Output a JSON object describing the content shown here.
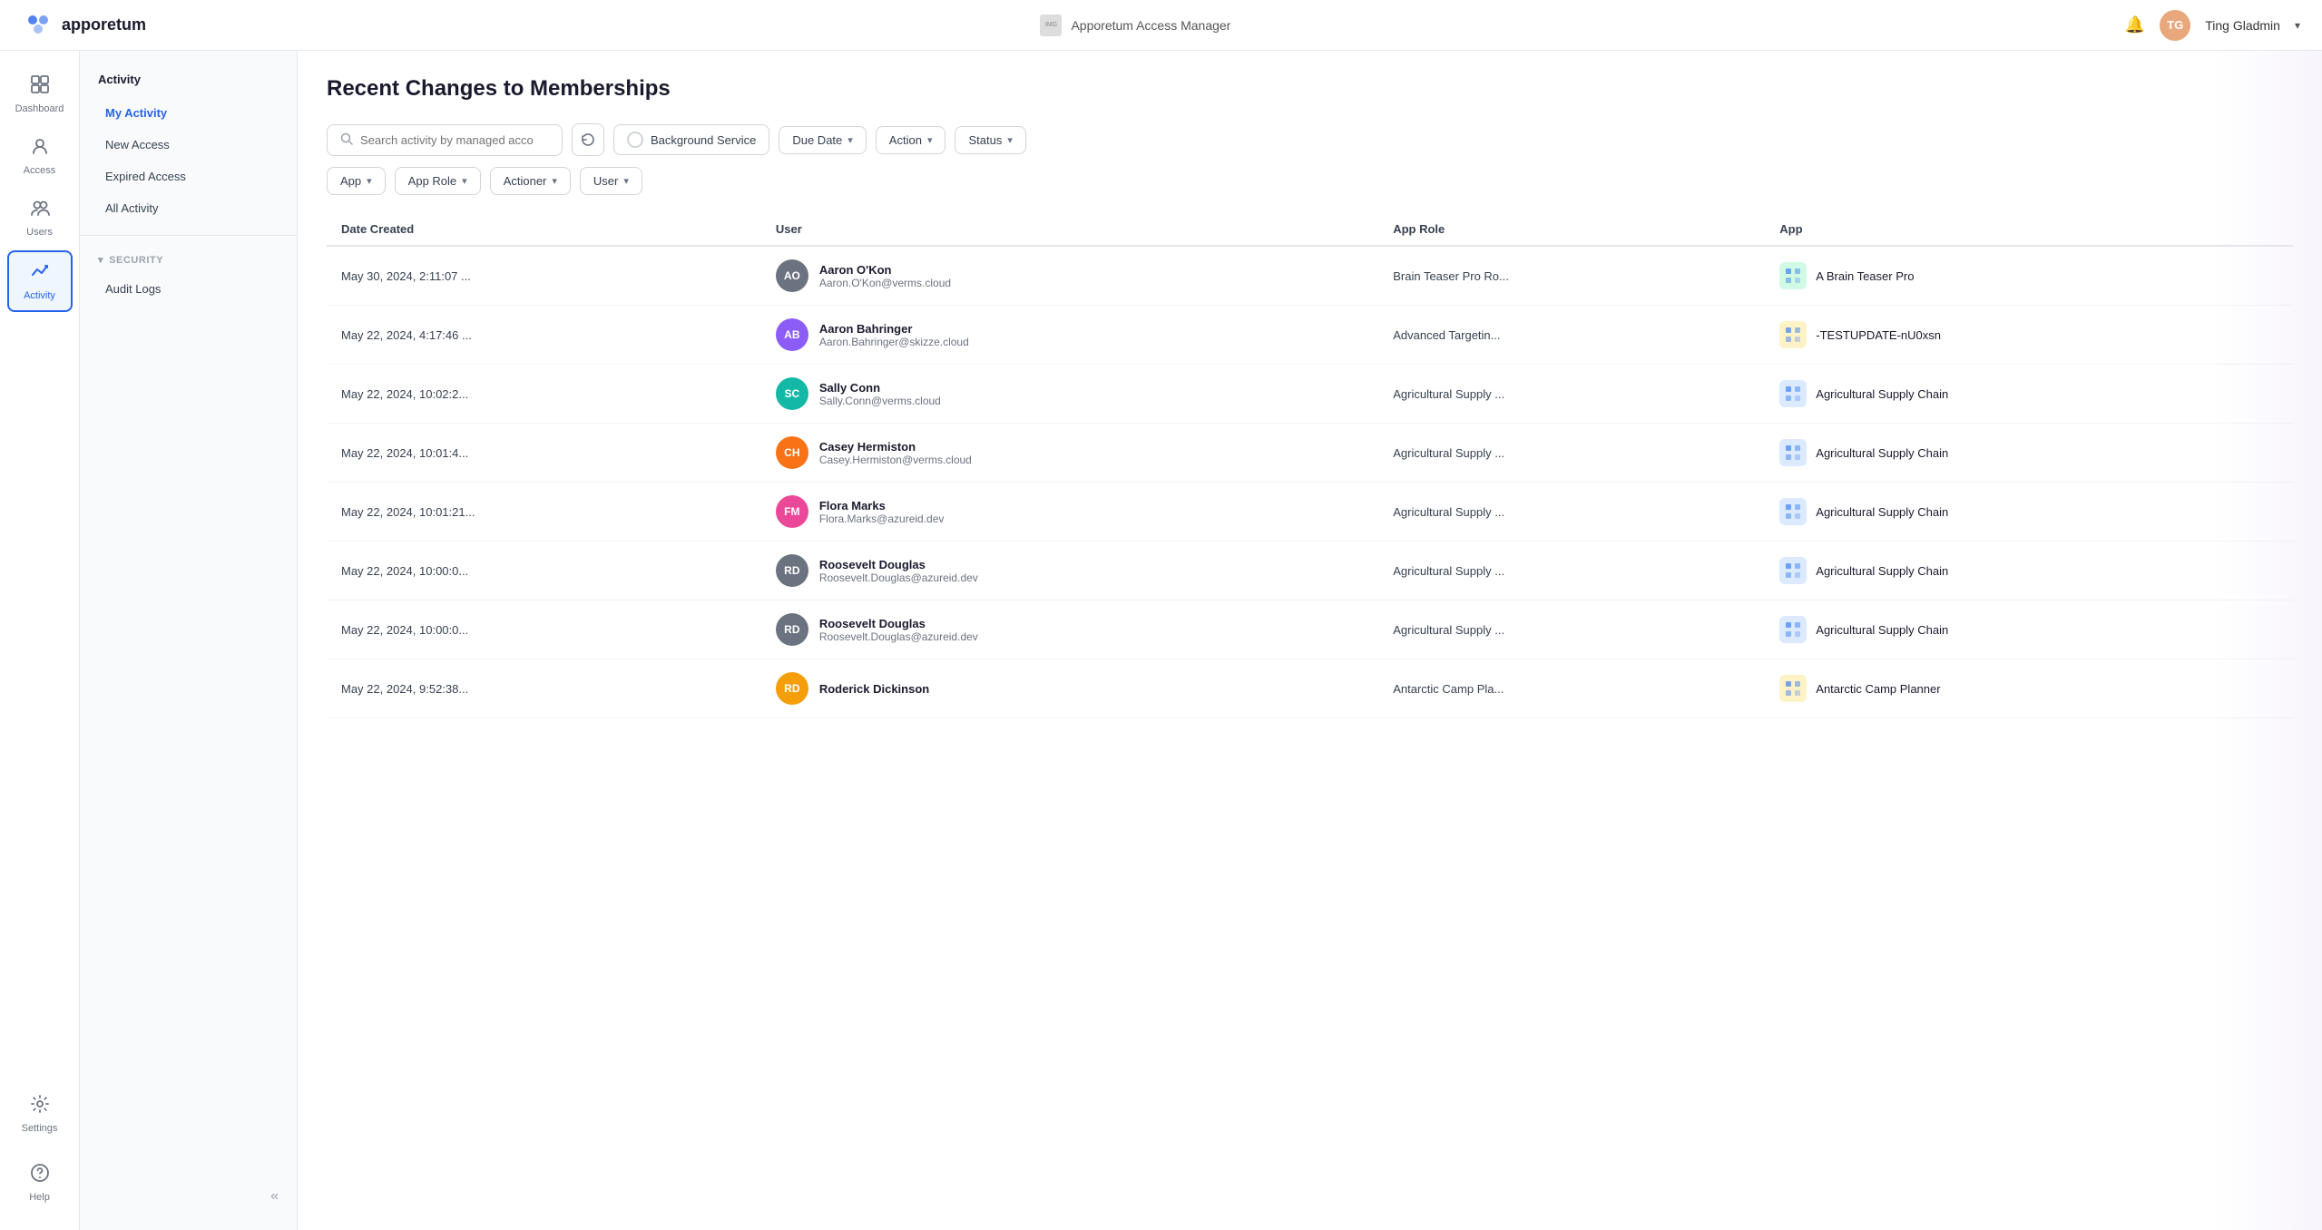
{
  "header": {
    "logo_text": "apporetum",
    "org_logo_alt": "Organisation Logo",
    "app_name": "Apporetum Access Manager",
    "bell_icon": "🔔",
    "user_initials": "TG",
    "user_name": "Ting Gladmin",
    "chevron": "▾"
  },
  "sidebar_left": {
    "items": [
      {
        "id": "dashboard",
        "label": "Dashboard",
        "icon": "⊞"
      },
      {
        "id": "access",
        "label": "Access",
        "icon": "👤"
      },
      {
        "id": "users",
        "label": "Users",
        "icon": "👥"
      },
      {
        "id": "activity",
        "label": "Activity",
        "icon": "↗"
      },
      {
        "id": "settings",
        "label": "Settings",
        "icon": "⚙"
      }
    ],
    "help_label": "Help",
    "help_icon": "?"
  },
  "sidebar_second": {
    "title": "Activity",
    "menu_items": [
      {
        "id": "my-activity",
        "label": "My Activity",
        "active": true
      },
      {
        "id": "new-access",
        "label": "New Access"
      },
      {
        "id": "expired-access",
        "label": "Expired Access"
      },
      {
        "id": "all-activity",
        "label": "All Activity"
      }
    ],
    "security_section": {
      "label": "SECURITY",
      "items": [
        {
          "id": "audit-logs",
          "label": "Audit Logs"
        }
      ]
    },
    "collapse_icon": "«"
  },
  "main": {
    "page_title": "Recent Changes to Memberships",
    "search_placeholder": "Search activity by managed acco",
    "filters_row1": [
      {
        "id": "background-service",
        "label": "Background Service",
        "type": "radio"
      },
      {
        "id": "due-date",
        "label": "Due Date",
        "chevron": "▾"
      },
      {
        "id": "action",
        "label": "Action",
        "chevron": "▾"
      },
      {
        "id": "status",
        "label": "Status",
        "chevron": "▾"
      }
    ],
    "filters_row2": [
      {
        "id": "app",
        "label": "App",
        "chevron": "▾"
      },
      {
        "id": "app-role",
        "label": "App Role",
        "chevron": "▾"
      },
      {
        "id": "actioner",
        "label": "Actioner",
        "chevron": "▾"
      },
      {
        "id": "user",
        "label": "User",
        "chevron": "▾"
      }
    ],
    "table": {
      "columns": [
        "Date Created",
        "User",
        "App Role",
        "App"
      ],
      "rows": [
        {
          "date": "May 30, 2024, 2:11:07 ...",
          "user_initials": "AO",
          "user_name": "Aaron O'Kon",
          "user_email": "Aaron.O'Kon@verms.cloud",
          "avatar_color": "#6b7280",
          "app_role": "Brain Teaser Pro Ro...",
          "app_icon": "🧩",
          "app_icon_bg": "#d1fae5",
          "app_name": "A Brain Teaser Pro"
        },
        {
          "date": "May 22, 2024, 4:17:46 ...",
          "user_initials": "AB",
          "user_name": "Aaron Bahringer",
          "user_email": "Aaron.Bahringer@skizze.cloud",
          "avatar_color": "#8b5cf6",
          "app_role": "Advanced Targetin...",
          "app_icon": "🧩",
          "app_icon_bg": "#fef3c7",
          "app_name": "-TESTUPDATE-nU0xsn"
        },
        {
          "date": "May 22, 2024, 10:02:2...",
          "user_initials": "SC",
          "user_name": "Sally Conn",
          "user_email": "Sally.Conn@verms.cloud",
          "avatar_color": "#14b8a6",
          "app_role": "Agricultural Supply ...",
          "app_icon": "🧩",
          "app_icon_bg": "#dbeafe",
          "app_name": "Agricultural Supply Chain"
        },
        {
          "date": "May 22, 2024, 10:01:4...",
          "user_initials": "CH",
          "user_name": "Casey Hermiston",
          "user_email": "Casey.Hermiston@verms.cloud",
          "avatar_color": "#f97316",
          "app_role": "Agricultural Supply ...",
          "app_icon": "🧩",
          "app_icon_bg": "#dbeafe",
          "app_name": "Agricultural Supply Chain"
        },
        {
          "date": "May 22, 2024, 10:01:21...",
          "user_initials": "FM",
          "user_name": "Flora Marks",
          "user_email": "Flora.Marks@azureid.dev",
          "avatar_color": "#ec4899",
          "app_role": "Agricultural Supply ...",
          "app_icon": "🧩",
          "app_icon_bg": "#dbeafe",
          "app_name": "Agricultural Supply Chain"
        },
        {
          "date": "May 22, 2024, 10:00:0...",
          "user_initials": "RD",
          "user_name": "Roosevelt Douglas",
          "user_email": "Roosevelt.Douglas@azureid.dev",
          "avatar_color": "#6b7280",
          "app_role": "Agricultural Supply ...",
          "app_icon": "🧩",
          "app_icon_bg": "#dbeafe",
          "app_name": "Agricultural Supply Chain"
        },
        {
          "date": "May 22, 2024, 10:00:0...",
          "user_initials": "RD",
          "user_name": "Roosevelt Douglas",
          "user_email": "Roosevelt.Douglas@azureid.dev",
          "avatar_color": "#6b7280",
          "app_role": "Agricultural Supply ...",
          "app_icon": "🧩",
          "app_icon_bg": "#dbeafe",
          "app_name": "Agricultural Supply Chain"
        },
        {
          "date": "May 22, 2024, 9:52:38...",
          "user_initials": "RD",
          "user_name": "Roderick Dickinson",
          "user_email": "",
          "avatar_color": "#f59e0b",
          "app_role": "Antarctic Camp Pla...",
          "app_icon": "🧩",
          "app_icon_bg": "#fef3c7",
          "app_name": "Antarctic Camp Planner"
        }
      ]
    }
  }
}
